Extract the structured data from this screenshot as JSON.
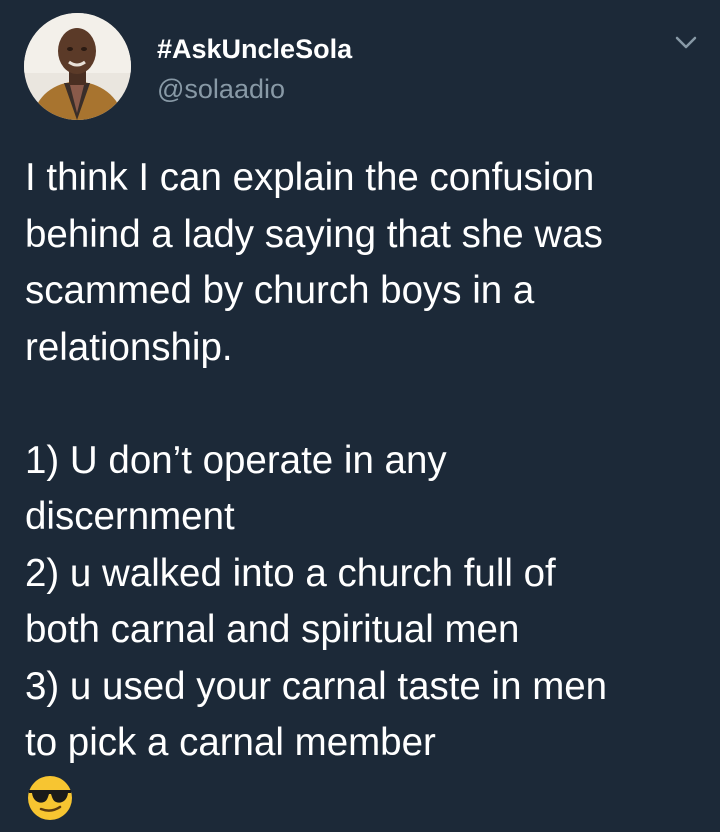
{
  "user": {
    "display_name": "#AskUncleSola",
    "handle": "@solaadio",
    "avatar_icon": "profile-photo"
  },
  "menu": {
    "icon": "chevron-down-icon"
  },
  "tweet": {
    "paragraph1": [
      "I think I can explain the confusion",
      "behind a lady saying that she was",
      "scammed by church boys in a",
      "relationship."
    ],
    "paragraph2": [
      "1) U don’t operate in any",
      "discernment",
      "2) u walked into a church full of",
      "both carnal and spiritual men",
      "3) u used your carnal taste in men",
      "to pick a carnal member"
    ],
    "emoji": "😎"
  },
  "colors": {
    "background": "#1c2938",
    "text": "#ffffff",
    "secondary_text": "#8899a6"
  }
}
